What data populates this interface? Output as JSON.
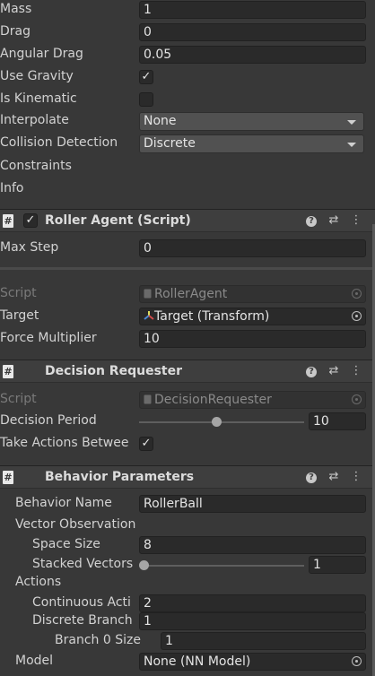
{
  "rigidbody": {
    "mass_label": "Mass",
    "mass_value": "1",
    "drag_label": "Drag",
    "drag_value": "0",
    "angular_drag_label": "Angular Drag",
    "angular_drag_value": "0.05",
    "use_gravity_label": "Use Gravity",
    "use_gravity_checked": "✓",
    "is_kinematic_label": "Is Kinematic",
    "interpolate_label": "Interpolate",
    "interpolate_value": "None",
    "collision_label": "Collision Detection",
    "collision_value": "Discrete",
    "constraints_label": "Constraints",
    "info_label": "Info"
  },
  "roller_agent": {
    "title": "Roller Agent (Script)",
    "enabled_check": "✓",
    "max_step_label": "Max Step",
    "max_step_value": "0",
    "script_label": "Script",
    "script_value": "RollerAgent",
    "target_label": "Target",
    "target_value": "Target (Transform)",
    "force_label": "Force Multiplier",
    "force_value": "10"
  },
  "decision_requester": {
    "title": "Decision Requester",
    "script_label": "Script",
    "script_value": "DecisionRequester",
    "period_label": "Decision Period",
    "period_value": "10",
    "period_fraction": 0.47,
    "take_actions_label": "Take Actions Betwee",
    "take_actions_checked": "✓"
  },
  "behavior_parameters": {
    "title": "Behavior Parameters",
    "behavior_name_label": "Behavior Name",
    "behavior_name_value": "RollerBall",
    "vector_obs_label": "Vector Observation",
    "space_size_label": "Space Size",
    "space_size_value": "8",
    "stacked_label": "Stacked Vectors",
    "stacked_value": "1",
    "stacked_fraction": 0.0,
    "actions_label": "Actions",
    "continuous_label": "Continuous Acti",
    "continuous_value": "2",
    "discrete_label": "Discrete Branch",
    "discrete_value": "1",
    "branch0_label": "Branch 0 Size",
    "branch0_value": "1",
    "model_label": "Model",
    "model_value": "None (NN Model)"
  },
  "icons": {
    "script": "#",
    "help": "?",
    "presets": "⇄",
    "menu": "⋮"
  },
  "colors": {
    "background": "#383838",
    "field": "#2a2a2a",
    "header": "#3e3e3e"
  }
}
